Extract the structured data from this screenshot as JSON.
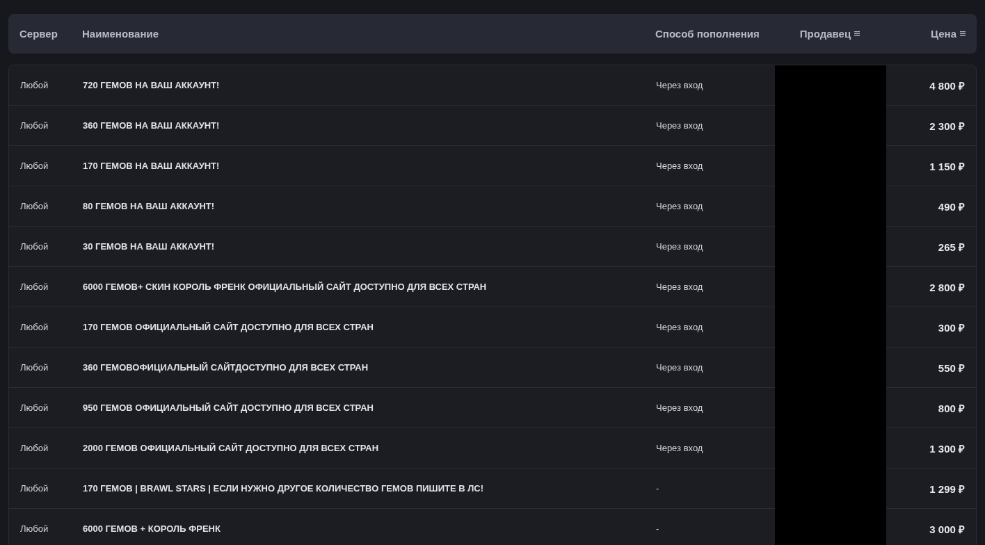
{
  "table": {
    "columns": [
      {
        "label": "Сервер",
        "sortable": false
      },
      {
        "label": "Наименование",
        "sortable": false
      },
      {
        "label": "Способ пополнения",
        "sortable": false
      },
      {
        "label": "Продавец",
        "sortable": true
      },
      {
        "label": "Цена",
        "sortable": true
      }
    ],
    "rows": [
      {
        "server": "Любой",
        "name": "720 ГЕМОВ НА ВАШ АККАУНТ!",
        "method": "Через вход",
        "price": "4 800 ₽"
      },
      {
        "server": "Любой",
        "name": "360 ГЕМОВ НА ВАШ АККАУНТ!",
        "method": "Через вход",
        "price": "2 300 ₽"
      },
      {
        "server": "Любой",
        "name": "170 ГЕМОВ НА ВАШ АККАУНТ!",
        "method": "Через вход",
        "price": "1 150 ₽"
      },
      {
        "server": "Любой",
        "name": "80 ГЕМОВ НА ВАШ АККАУНТ!",
        "method": "Через вход",
        "price": "490 ₽"
      },
      {
        "server": "Любой",
        "name": "30 ГЕМОВ НА ВАШ АККАУНТ!",
        "method": "Через вход",
        "price": "265 ₽"
      },
      {
        "server": "Любой",
        "name": "6000 ГЕМОВ+ СКИН КОРОЛЬ ФРЕНК ОФИЦИАЛЬНЫЙ САЙТ ДОСТУПНО ДЛЯ ВСЕХ СТРАН",
        "method": "Через вход",
        "price": "2 800 ₽"
      },
      {
        "server": "Любой",
        "name": "170 ГЕМОВ ОФИЦИАЛЬНЫЙ САЙТ ДОСТУПНО ДЛЯ ВСЕХ СТРАН",
        "method": "Через вход",
        "price": "300 ₽"
      },
      {
        "server": "Любой",
        "name": "360 ГЕМОВОФИЦИАЛЬНЫЙ САЙТДОСТУПНО ДЛЯ ВСЕХ СТРАН",
        "method": "Через вход",
        "price": "550 ₽"
      },
      {
        "server": "Любой",
        "name": "950 ГЕМОВ ОФИЦИАЛЬНЫЙ САЙТ ДОСТУПНО ДЛЯ ВСЕХ СТРАН",
        "method": "Через вход",
        "price": "800 ₽"
      },
      {
        "server": "Любой",
        "name": "2000 ГЕМОВ ОФИЦИАЛЬНЫЙ САЙТ ДОСТУПНО ДЛЯ ВСЕХ СТРАН",
        "method": "Через вход",
        "price": "1 300 ₽"
      },
      {
        "server": "Любой",
        "name": "170 ГЕМОВ | BRAWL STARS | ЕСЛИ НУЖНО ДРУГОЕ КОЛИЧЕСТВО ГЕМОВ ПИШИТЕ В ЛС!",
        "method": "-",
        "price": "1 299 ₽"
      },
      {
        "server": "Любой",
        "name": "6000 ГЕМОВ + КОРОЛЬ ФРЕНК",
        "method": "-",
        "price": "3 000 ₽"
      }
    ]
  }
}
